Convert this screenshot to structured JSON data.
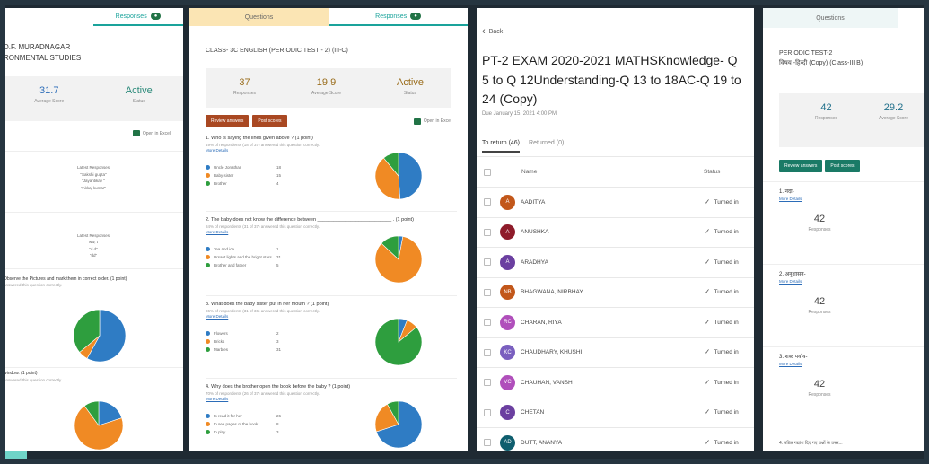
{
  "panel1": {
    "tab_responses": "Responses",
    "title_line1": "D.F. MURADNAGAR",
    "title_line2": "RONMENTAL STUDIES",
    "avg_score_value": "31.7",
    "avg_score_label": "Average Score",
    "status_value": "Active",
    "status_label": "Status",
    "open_excel": "Open in Excel",
    "latest1_label": "Latest Responses",
    "latest1_items": [
      "\"Sakshi gupta\"",
      "\"Jayantikay \"",
      "\"Akkaj kumar\""
    ],
    "latest2_label": "Latest Responses",
    "latest2_items": [
      "\"ww, t\"",
      "\"d d\"",
      "\"dd\""
    ],
    "q_observe": "Observe the Pictures and mark them in correct order. (1 point)",
    "q_observe_sub": "answered this question correctly.",
    "q_window": "window. (1 point)",
    "q_window_sub": "answered this question correctly."
  },
  "panel2": {
    "tab_questions": "Questions",
    "tab_responses": "Responses",
    "class_title": "CLASS- 3C ENGLISH  (PERIODIC TEST - 2)  (III-C)",
    "responses_value": "37",
    "responses_label": "Responses",
    "avg_value": "19.9",
    "avg_label": "Average Score",
    "status_value": "Active",
    "status_label": "Status",
    "review_btn": "Review answers",
    "post_btn": "Post scores",
    "open_excel": "Open in Excel",
    "questions": [
      {
        "text": "1. Who is saying the lines given above ? (1 point)",
        "sub": "49% of respondents (18 of 37) answered this question correctly.",
        "link": "More Details",
        "options": [
          "Uncle Jonathan",
          "Baby sister",
          "Brother"
        ],
        "counts": [
          "18",
          "15",
          "4"
        ]
      },
      {
        "text": "2. The baby does not know the difference between ___________________________ . (1 point)",
        "sub": "84% of respondents (31 of 37) answered this question correctly.",
        "link": "More Details",
        "options": [
          "Tea and ice",
          "Ursant lights and the bright stars",
          "Brother and father"
        ],
        "counts": [
          "1",
          "31",
          "5"
        ]
      },
      {
        "text": "3. What does the baby sister put in her mouth ? (1 point)",
        "sub": "86% of respondents (31 of 36) answered this question correctly.",
        "link": "More Details",
        "options": [
          "Flowers",
          "Bricks",
          "Marbles"
        ],
        "counts": [
          "2",
          "3",
          "31"
        ]
      },
      {
        "text": "4. Why does the brother open the book before the baby ? (1 point)",
        "sub": "70% of respondents (26 of 37) answered this question correctly.",
        "link": "More Details",
        "options": [
          "to read it for her",
          "to see pages of the book",
          "to play"
        ],
        "counts": [
          "26",
          "8",
          "3"
        ]
      }
    ]
  },
  "panel3": {
    "back_label": "Back",
    "title": "PT-2 EXAM 2020-2021 MATHSKnowledge- Q 5 to Q 12Understanding-Q 13 to 18AC-Q 19 to 24 (Copy)",
    "due": "Due January 15, 2021 4:00 PM",
    "tab_to_return": "To return (46)",
    "tab_returned": "Returned (0)",
    "col_name": "Name",
    "col_status": "Status",
    "rows": [
      {
        "initials": "A",
        "name": "AADITYA",
        "status": "Turned in",
        "color": "#c2571a"
      },
      {
        "initials": "A",
        "name": "ANUSHKA",
        "status": "Turned in",
        "color": "#8e1b2a"
      },
      {
        "initials": "A",
        "name": "ARADHYA",
        "status": "Turned in",
        "color": "#6b3fa0"
      },
      {
        "initials": "NB",
        "name": "BHAGWANA, NIRBHAY",
        "status": "Turned in",
        "color": "#c2571a"
      },
      {
        "initials": "RC",
        "name": "CHARAN, RIYA",
        "status": "Turned in",
        "color": "#b04fbb"
      },
      {
        "initials": "KC",
        "name": "CHAUDHARY, KHUSHI",
        "status": "Turned in",
        "color": "#7a5fbf"
      },
      {
        "initials": "VC",
        "name": "CHAUHAN, VANSH",
        "status": "Turned in",
        "color": "#b04fbb"
      },
      {
        "initials": "C",
        "name": "CHETAN",
        "status": "Turned in",
        "color": "#6b3fa0"
      },
      {
        "initials": "AD",
        "name": "DUTT, ANANYA",
        "status": "Turned in",
        "color": "#0f5e6e"
      }
    ]
  },
  "panel4": {
    "tab_questions": "Questions",
    "title_line1": "PERIODIC TEST-2",
    "title_line2": "विषय -हिन्दी (Copy) (Class-III B)",
    "responses_value": "42",
    "responses_label": "Responses",
    "avg_value": "29.2",
    "avg_label": "Average Score",
    "review_btn": "Review answers",
    "post_btn": "Post scores",
    "questions": [
      {
        "text": "1. नदा-",
        "link": "More Details",
        "count": "42",
        "label": "Responses"
      },
      {
        "text": "2. अनुशासन-",
        "link": "More Details",
        "count": "42",
        "label": "Responses"
      },
      {
        "text": "3. शब्द पर्याय-",
        "link": "More Details",
        "count": "42",
        "label": "Responses"
      }
    ],
    "bottom_text": "4. पठित गद्यांश दिए गए प्रश्नों के उत्तर..."
  },
  "colors": {
    "blue": "#2f7cc4",
    "orange": "#f08a24",
    "green": "#2e9e3e",
    "teal": "#1aa39b",
    "excel_green": "#217346"
  },
  "charts": {
    "p1_pie1": [
      {
        "value": 0.58,
        "color": "#2f7cc4"
      },
      {
        "value": 0.06,
        "color": "#f08a24"
      },
      {
        "value": 0.36,
        "color": "#2e9e3e"
      }
    ],
    "p1_pie2": [
      {
        "value": 0.2,
        "color": "#2f7cc4"
      },
      {
        "value": 0.7,
        "color": "#f08a24"
      },
      {
        "value": 0.1,
        "color": "#2e9e3e"
      }
    ],
    "p2_q1": [
      {
        "value": 0.49,
        "color": "#2f7cc4"
      },
      {
        "value": 0.4,
        "color": "#f08a24"
      },
      {
        "value": 0.11,
        "color": "#2e9e3e"
      }
    ],
    "p2_q2": [
      {
        "value": 0.03,
        "color": "#2f7cc4"
      },
      {
        "value": 0.84,
        "color": "#f08a24"
      },
      {
        "value": 0.13,
        "color": "#2e9e3e"
      }
    ],
    "p2_q3": [
      {
        "value": 0.06,
        "color": "#2f7cc4"
      },
      {
        "value": 0.08,
        "color": "#f08a24"
      },
      {
        "value": 0.86,
        "color": "#2e9e3e"
      }
    ],
    "p2_q4": [
      {
        "value": 0.7,
        "color": "#2f7cc4"
      },
      {
        "value": 0.22,
        "color": "#f08a24"
      },
      {
        "value": 0.08,
        "color": "#2e9e3e"
      }
    ]
  }
}
